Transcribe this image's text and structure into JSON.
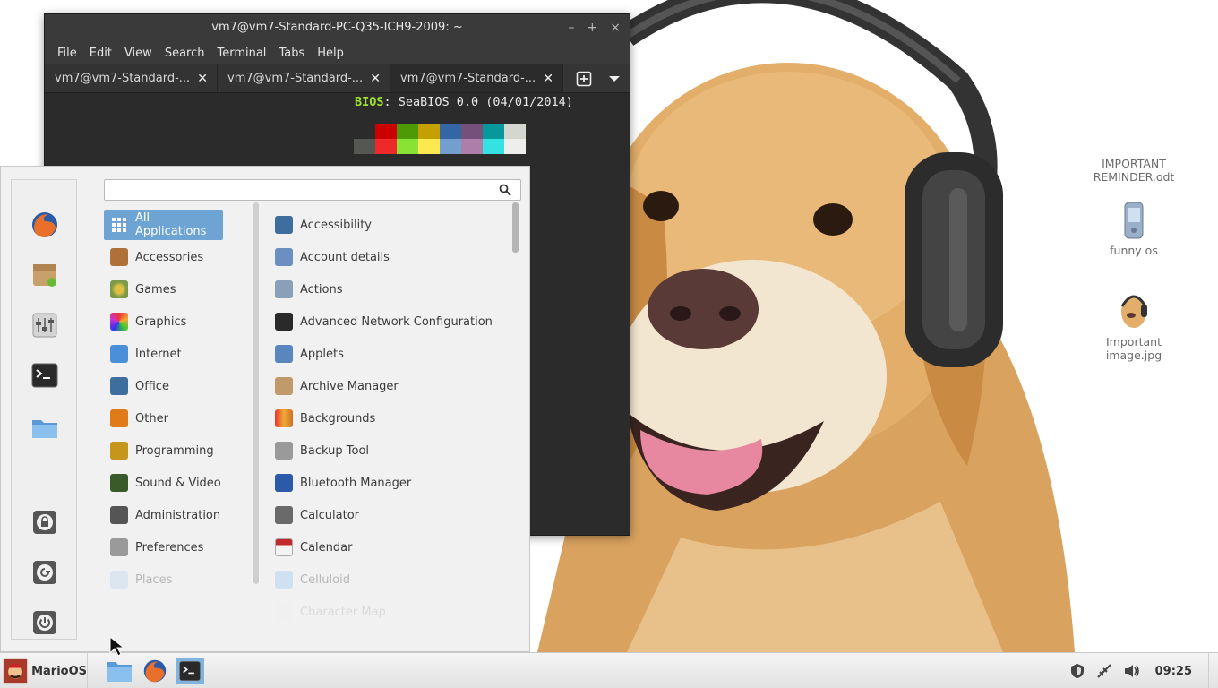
{
  "terminal": {
    "title": "vm7@vm7-Standard-PC-Q35-ICH9-2009: ~",
    "window_buttons": [
      "–",
      "+",
      "×"
    ],
    "menu": [
      "File",
      "Edit",
      "View",
      "Search",
      "Terminal",
      "Tabs",
      "Help"
    ],
    "tabs": [
      {
        "label": "vm7@vm7-Standard-..."
      },
      {
        "label": "vm7@vm7-Standard-..."
      },
      {
        "label": "vm7@vm7-Standard-..."
      }
    ],
    "bios_label": "BIOS",
    "bios_value": ": SeaBIOS 0.0 (04/01/2014)",
    "palette_colors": [
      "#2b2b2b",
      "#cc0000",
      "#4e9a06",
      "#c4a000",
      "#3465a4",
      "#75507b",
      "#06989a",
      "#d3d7cf",
      "#555753",
      "#ef2929",
      "#8ae234",
      "#fce94f",
      "#729fcf",
      "#ad7fa8",
      "#34e2e2",
      "#eeeeec"
    ]
  },
  "menu": {
    "search_value": "",
    "categories": [
      {
        "label": "All Applications",
        "icon": "grid-icon",
        "color": "#ffffff"
      },
      {
        "label": "Accessories",
        "icon": "accessories-icon",
        "color": "#b0703a"
      },
      {
        "label": "Games",
        "icon": "games-icon",
        "color": "#7a9a4a"
      },
      {
        "label": "Graphics",
        "icon": "graphics-icon",
        "color": "#d23c8c"
      },
      {
        "label": "Internet",
        "icon": "internet-icon",
        "color": "#4a90d9"
      },
      {
        "label": "Office",
        "icon": "office-icon",
        "color": "#3d6e9e"
      },
      {
        "label": "Other",
        "icon": "other-icon",
        "color": "#e07b1a"
      },
      {
        "label": "Programming",
        "icon": "programming-icon",
        "color": "#c6951c"
      },
      {
        "label": "Sound & Video",
        "icon": "sound-video-icon",
        "color": "#3a5a2a"
      },
      {
        "label": "Administration",
        "icon": "administration-icon",
        "color": "#555555"
      },
      {
        "label": "Preferences",
        "icon": "preferences-icon",
        "color": "#9a9a9a"
      },
      {
        "label": "Places",
        "icon": "places-icon",
        "color": "#c6d8e8"
      }
    ],
    "apps": [
      {
        "label": "Accessibility",
        "icon": "accessibility-icon",
        "color": "#3d6e9e"
      },
      {
        "label": "Account details",
        "icon": "account-icon",
        "color": "#6a8fc0"
      },
      {
        "label": "Actions",
        "icon": "actions-icon",
        "color": "#8aa0b8"
      },
      {
        "label": "Advanced Network Configuration",
        "icon": "network-icon",
        "color": "#2a2a2a"
      },
      {
        "label": "Applets",
        "icon": "applets-icon",
        "color": "#5a86c0"
      },
      {
        "label": "Archive Manager",
        "icon": "archive-icon",
        "color": "#c09a6a"
      },
      {
        "label": "Backgrounds",
        "icon": "backgrounds-icon",
        "color": "#d0702a"
      },
      {
        "label": "Backup Tool",
        "icon": "backup-icon",
        "color": "#9a9a9a"
      },
      {
        "label": "Bluetooth Manager",
        "icon": "bluetooth-icon",
        "color": "#2a5aa8"
      },
      {
        "label": "Calculator",
        "icon": "calculator-icon",
        "color": "#6a6a6a"
      },
      {
        "label": "Calendar",
        "icon": "calendar-icon",
        "color": "#c02a2a"
      },
      {
        "label": "Celluloid",
        "icon": "celluloid-icon",
        "color": "#a8c8e8"
      },
      {
        "label": "Character Map",
        "icon": "charmap-icon",
        "color": "#e8e8e8"
      }
    ]
  },
  "desktop": {
    "icons": [
      {
        "label": "IMPORTANT REMINDER.odt",
        "icon": "document-icon"
      },
      {
        "label": "funny os",
        "icon": "phone-icon"
      },
      {
        "label": "Important image.jpg",
        "icon": "image-icon"
      }
    ]
  },
  "taskbar": {
    "start_label": "MarioOS",
    "clock": "09:25"
  }
}
